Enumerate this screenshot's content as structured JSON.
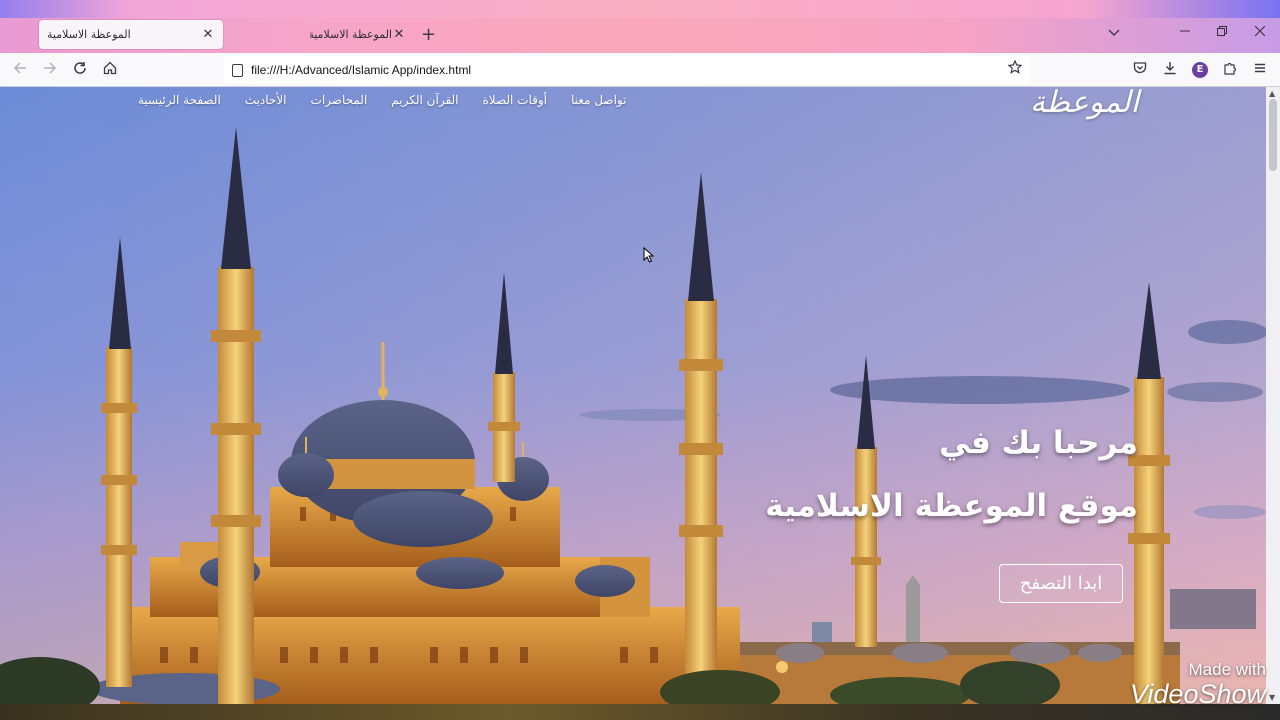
{
  "browser": {
    "tabs": [
      {
        "title": "الموعظة الاسلامية",
        "active": true
      },
      {
        "title": "الموعظة الاسلامية",
        "active": false
      }
    ],
    "new_tab_symbol": "+",
    "close_symbol": "✕",
    "url": "file:///H:/Advanced/Islamic App/index.html",
    "extension_letter": "E",
    "icons": [
      "back-icon",
      "forward-icon",
      "reload-icon",
      "home-icon",
      "page-icon",
      "bookmark-star-icon",
      "pocket-icon",
      "download-icon",
      "extensions-icon",
      "menu-icon",
      "list-all-tabs-icon",
      "minimize-icon",
      "restore-icon",
      "close-window-icon"
    ]
  },
  "site": {
    "logo_text": "الموعظة",
    "nav": [
      "الصفحة الرئيسية",
      "الأحاديث",
      "المحاضرات",
      "القرآن الكريم",
      "أوقات الصلاة",
      "تواصل معنا"
    ],
    "hero_line1": "مرحبا بك في",
    "hero_line2": "موقع الموعظة الاسلامية",
    "cta_label": "ابدا التصفح"
  },
  "watermark": {
    "line1": "Made with",
    "line2": "VideoShow"
  }
}
